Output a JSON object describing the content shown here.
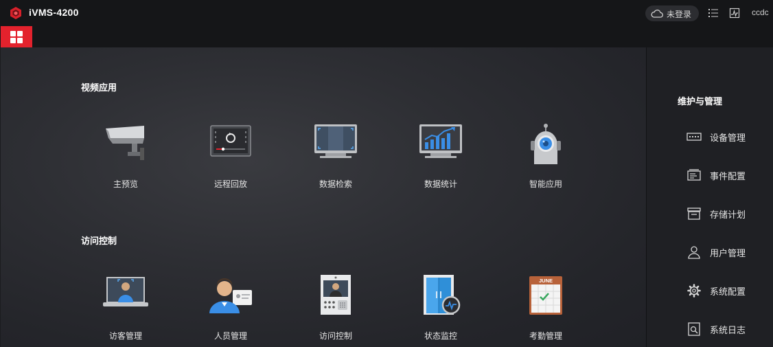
{
  "titlebar": {
    "app_title": "iVMS-4200",
    "login_label": "未登录",
    "user_name": "ccdc"
  },
  "colors": {
    "accent": "#e3222d",
    "icon_blue": "#3a8ee6"
  },
  "sections": {
    "video": {
      "title": "视频应用",
      "items": [
        {
          "label": "主预览",
          "icon": "camera-icon"
        },
        {
          "label": "远程回放",
          "icon": "playback-icon"
        },
        {
          "label": "数据检索",
          "icon": "search-monitor-icon"
        },
        {
          "label": "数据统计",
          "icon": "statistics-icon"
        },
        {
          "label": "智能应用",
          "icon": "robot-icon"
        }
      ]
    },
    "access": {
      "title": "访问控制",
      "items": [
        {
          "label": "访客管理",
          "icon": "visitor-laptop-icon"
        },
        {
          "label": "人员管理",
          "icon": "person-card-icon"
        },
        {
          "label": "访问控制",
          "icon": "door-intercom-icon"
        },
        {
          "label": "状态监控",
          "icon": "door-status-icon"
        },
        {
          "label": "考勤管理",
          "icon": "calendar-icon"
        }
      ],
      "calendar_month": "JUNE"
    }
  },
  "maintenance": {
    "title": "维护与管理",
    "items": [
      {
        "label": "设备管理",
        "icon": "device-icon"
      },
      {
        "label": "事件配置",
        "icon": "event-icon"
      },
      {
        "label": "存储计划",
        "icon": "storage-icon"
      },
      {
        "label": "用户管理",
        "icon": "user-icon"
      },
      {
        "label": "系统配置",
        "icon": "gear-icon"
      },
      {
        "label": "系统日志",
        "icon": "log-icon"
      }
    ]
  }
}
